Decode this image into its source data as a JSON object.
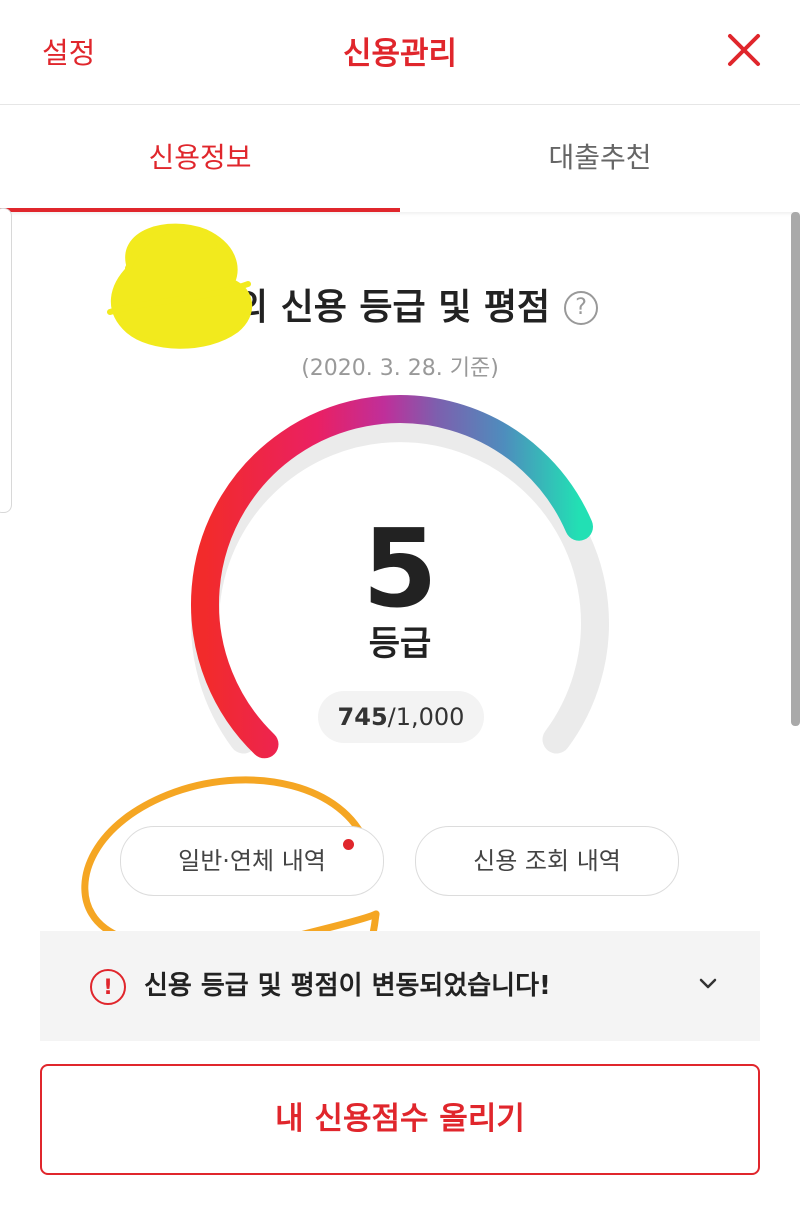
{
  "header": {
    "settings_label": "설정",
    "title": "신용관리"
  },
  "tabs": [
    {
      "label": "신용정보",
      "selected": true
    },
    {
      "label": "대출추천",
      "selected": false
    }
  ],
  "summary": {
    "headline": "님의 신용 등급 및 평점",
    "help_glyph": "?",
    "as_of": "(2020. 3. 28. 기준)"
  },
  "gauge": {
    "grade": "5",
    "grade_unit": "등급",
    "score": "745",
    "score_max": "/1,000",
    "score_value": 745,
    "score_range": [
      0,
      1000
    ],
    "gradient_colors": [
      "#f22b2b",
      "#ea2063",
      "#bf2f9a",
      "#7d5fae",
      "#4e8dbd",
      "#22e0b4"
    ],
    "track_color": "#ebebeb"
  },
  "actions": {
    "history_label": "일반·연체 내역",
    "history_has_badge": true,
    "inquiry_label": "신용 조회 내역"
  },
  "notice": {
    "icon_glyph": "!",
    "text": "신용 등급 및 평점이 변동되었습니다!"
  },
  "cta": {
    "label": "내 신용점수 올리기"
  },
  "colors": {
    "accent": "#e0262c",
    "annotation_yellow": "#f2ea1d",
    "annotation_orange": "#f5a623"
  }
}
